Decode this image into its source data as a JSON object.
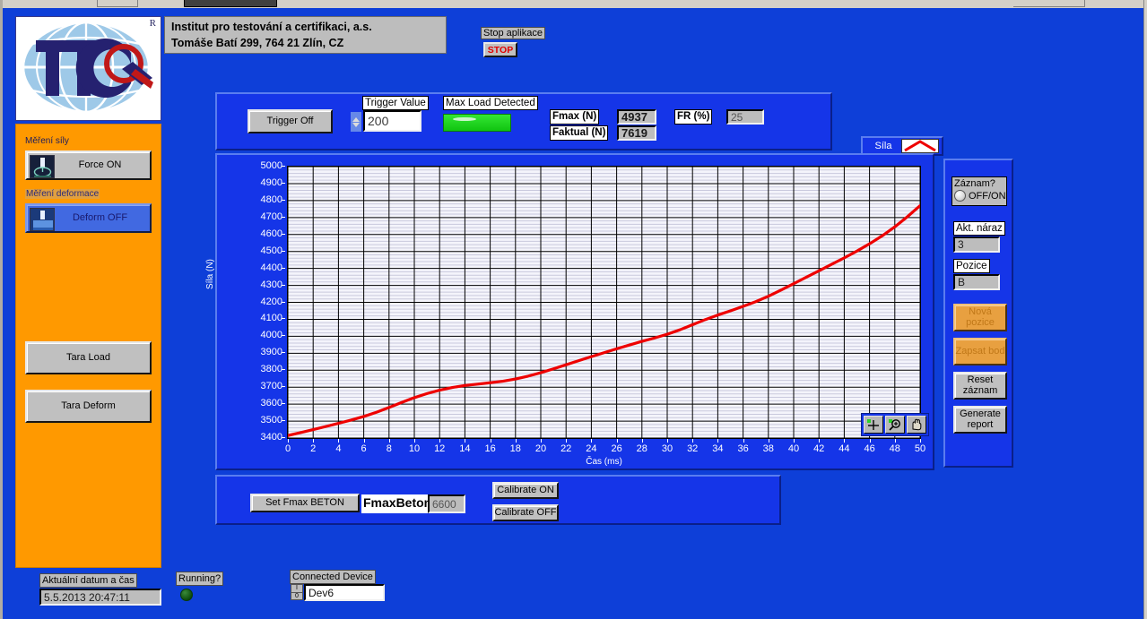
{
  "app": {
    "company_line1": "Institut pro testování a certifikaci, a.s.",
    "company_line2": "Tomáše Batí 299, 764 21 Zlín, CZ",
    "logo_trademark": "R",
    "logo_text": "ITC"
  },
  "stop": {
    "label": "Stop aplikace",
    "button": "STOP"
  },
  "sidebar": {
    "force_section_label": "Měření síly",
    "force_button": "Force ON",
    "deform_section_label": "Měření deformace",
    "deform_button": "Deform OFF",
    "tara_load": "Tara Load",
    "tara_deform": "Tara Deform"
  },
  "controls": {
    "trigger_button": "Trigger Off",
    "trigger_value_label": "Trigger Value",
    "trigger_value": "200",
    "max_load_label": "Max Load Detected",
    "fmax_label": "Fmax (N)",
    "fmax_value": "4937",
    "faktual_label": "Faktual (N)",
    "faktual_value": "7619",
    "fr_label": "FR (%)",
    "fr_value": "25"
  },
  "graph": {
    "legend_label": "Síla",
    "legend_color": "#ee0000",
    "palette": [
      "cursor-crosshair-icon",
      "zoom-magnifier-icon",
      "pan-hand-icon"
    ]
  },
  "record_panel": {
    "record_label": "Záznam?",
    "record_state": "OFF/ON",
    "akt_naraz_label": "Akt. náraz",
    "akt_naraz_value": "3",
    "pozice_label": "Pozice",
    "pozice_value": "B",
    "nova_pozice": "Nová pozice",
    "zapsat_bod": "Zapsat bod",
    "reset_zaznam": "Reset záznam",
    "generate_report": "Generate report"
  },
  "calibrate": {
    "set_fmax_button": "Set Fmax BETON",
    "fmax_beton_label": "FmaxBeton",
    "fmax_beton_value": "6600",
    "calibrate_on": "Calibrate ON",
    "calibrate_off": "Calibrate OFF"
  },
  "footer": {
    "datetime_label": "Aktuální datum a čas",
    "datetime_value": "5.5.2013  20:47:11",
    "running_label": "Running?",
    "device_label": "Connected Device",
    "device_value": "Dev6",
    "io_badge": "I/O"
  },
  "colors": {
    "window_blue": "#0e3fd8",
    "panel_blue": "#1535e8",
    "orange": "#ff9900",
    "plot_bg": "#f4f4fb",
    "curve_red": "#ee0000",
    "led_green": "#22d422"
  },
  "chart_data": {
    "type": "line",
    "title": "",
    "xlabel": "Čas (ms)",
    "ylabel": "Síla (N)",
    "xlim": [
      0,
      50
    ],
    "ylim": [
      3400,
      5000
    ],
    "xticks": [
      0,
      2,
      4,
      6,
      8,
      10,
      12,
      14,
      16,
      18,
      20,
      22,
      24,
      26,
      28,
      30,
      32,
      34,
      36,
      38,
      40,
      42,
      44,
      46,
      48,
      50
    ],
    "yticks": [
      3400,
      3500,
      3600,
      3700,
      3800,
      3900,
      4000,
      4100,
      4200,
      4300,
      4400,
      4500,
      4600,
      4700,
      4800,
      4900,
      5000
    ],
    "grid": true,
    "legend": "Síla",
    "legend_position": "top-right-outside",
    "series": [
      {
        "name": "Síla",
        "color": "#ee0000",
        "x": [
          0,
          1,
          2,
          3,
          4,
          5,
          6,
          7,
          8,
          9,
          10,
          11,
          12,
          13,
          14,
          15,
          16,
          17,
          18,
          19,
          20,
          21,
          22,
          23,
          24,
          25,
          26,
          27,
          28,
          29,
          30,
          31,
          32,
          33,
          34,
          35,
          36,
          37,
          38,
          39,
          40,
          41,
          42,
          43,
          44,
          45,
          46,
          47,
          48,
          49,
          50
        ],
        "y": [
          3415,
          3432,
          3450,
          3468,
          3487,
          3506,
          3527,
          3552,
          3580,
          3610,
          3638,
          3662,
          3682,
          3698,
          3710,
          3718,
          3726,
          3735,
          3748,
          3765,
          3785,
          3808,
          3832,
          3856,
          3880,
          3903,
          3926,
          3948,
          3970,
          3990,
          4012,
          4038,
          4068,
          4098,
          4125,
          4150,
          4176,
          4204,
          4236,
          4272,
          4310,
          4348,
          4386,
          4424,
          4462,
          4502,
          4545,
          4592,
          4645,
          4705,
          4770
        ]
      }
    ]
  }
}
